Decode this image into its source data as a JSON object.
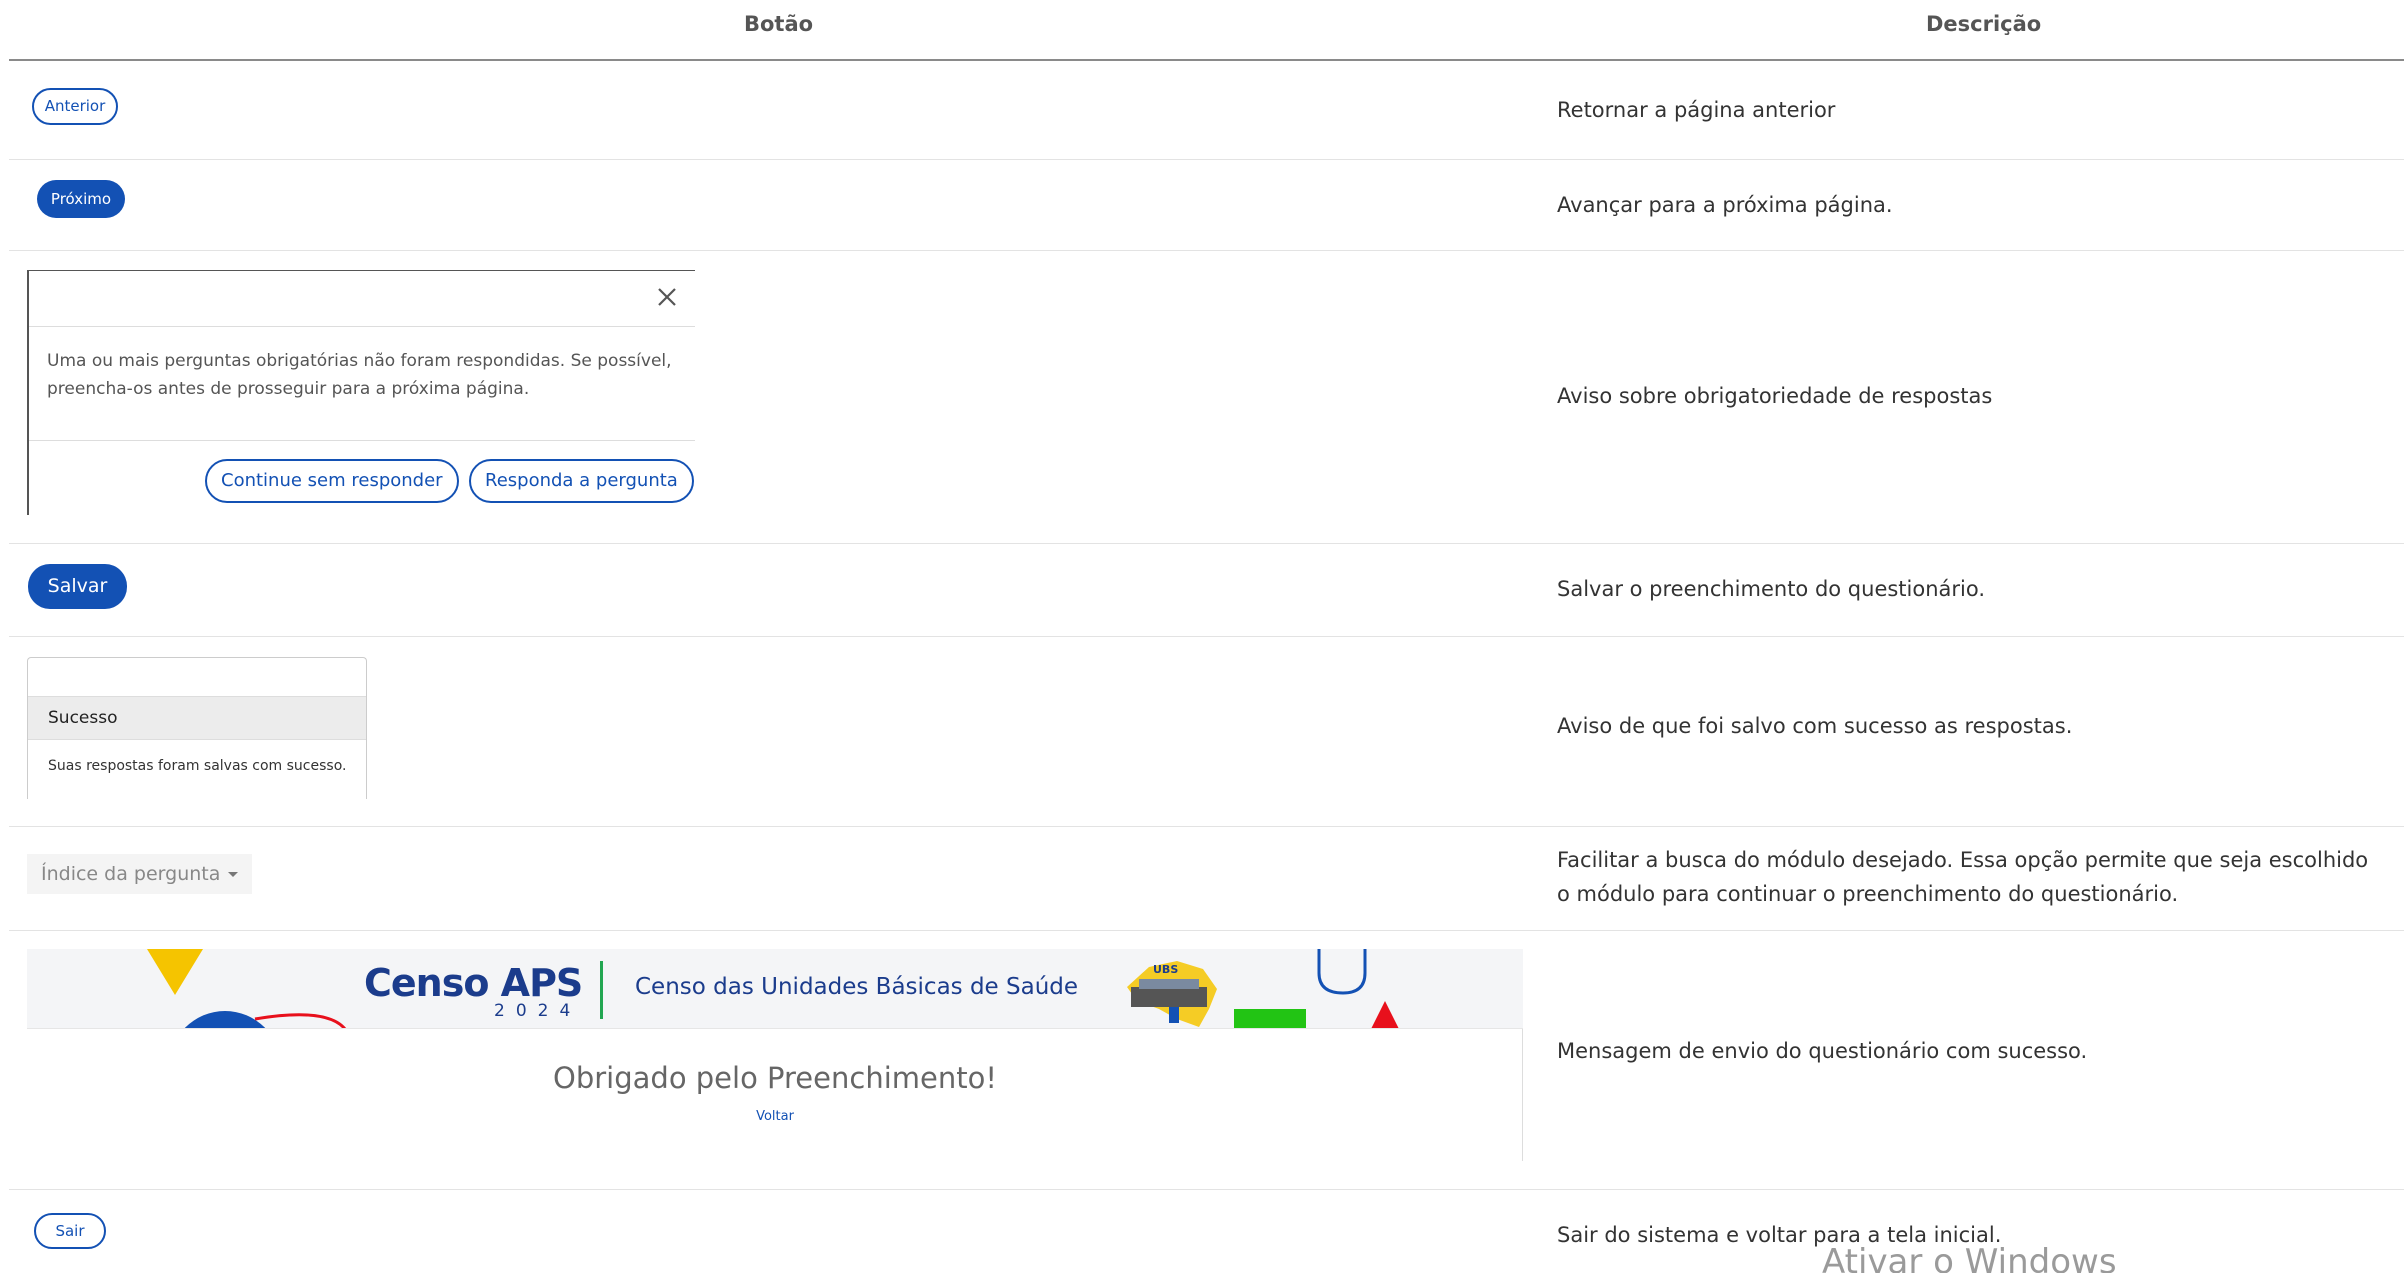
{
  "headers": {
    "button": "Botão",
    "description": "Descrição"
  },
  "rows": {
    "anterior": {
      "button_label": "Anterior",
      "description": "Retornar a página anterior"
    },
    "proximo": {
      "button_label": "Próximo",
      "description": "Avançar para a próxima página."
    },
    "aviso": {
      "modal_message": "Uma ou mais perguntas obrigatórias não foram respondidas. Se possível, preencha-os antes de prosseguir para a próxima página.",
      "continue_label": "Continue sem responder",
      "answer_label": "Responda a pergunta",
      "description": "Aviso sobre obrigatoriedade de respostas"
    },
    "salvar": {
      "button_label": "Salvar",
      "description": "Salvar o preenchimento do questionário."
    },
    "sucesso": {
      "toast_title": "Sucesso",
      "toast_message": "Suas respostas foram salvas com sucesso.",
      "description": "Aviso de que foi salvo com sucesso as respostas."
    },
    "indice": {
      "select_label": "Índice da pergunta",
      "description": "Facilitar a busca do módulo desejado. Essa opção permite que seja escolhido o módulo para continuar o preenchimento do questionário."
    },
    "envio": {
      "brand": "Censo APS",
      "brand_year": "2024",
      "banner_subtitle": "Censo das Unidades Básicas de Saúde",
      "logo_badge": "UBS",
      "thanks": "Obrigado pelo Preenchimento!",
      "back_label": "Voltar",
      "description": "Mensagem de envio do questionário com sucesso."
    },
    "sair": {
      "button_label": "Sair",
      "description": "Sair do sistema e voltar para a tela inicial."
    }
  },
  "watermark": "Ativar o Windows",
  "colors": {
    "primary": "#1351b4",
    "brand_dark": "#1b3c8c",
    "yellow": "#f5c400",
    "green": "#22c414",
    "red": "#e8101c"
  }
}
